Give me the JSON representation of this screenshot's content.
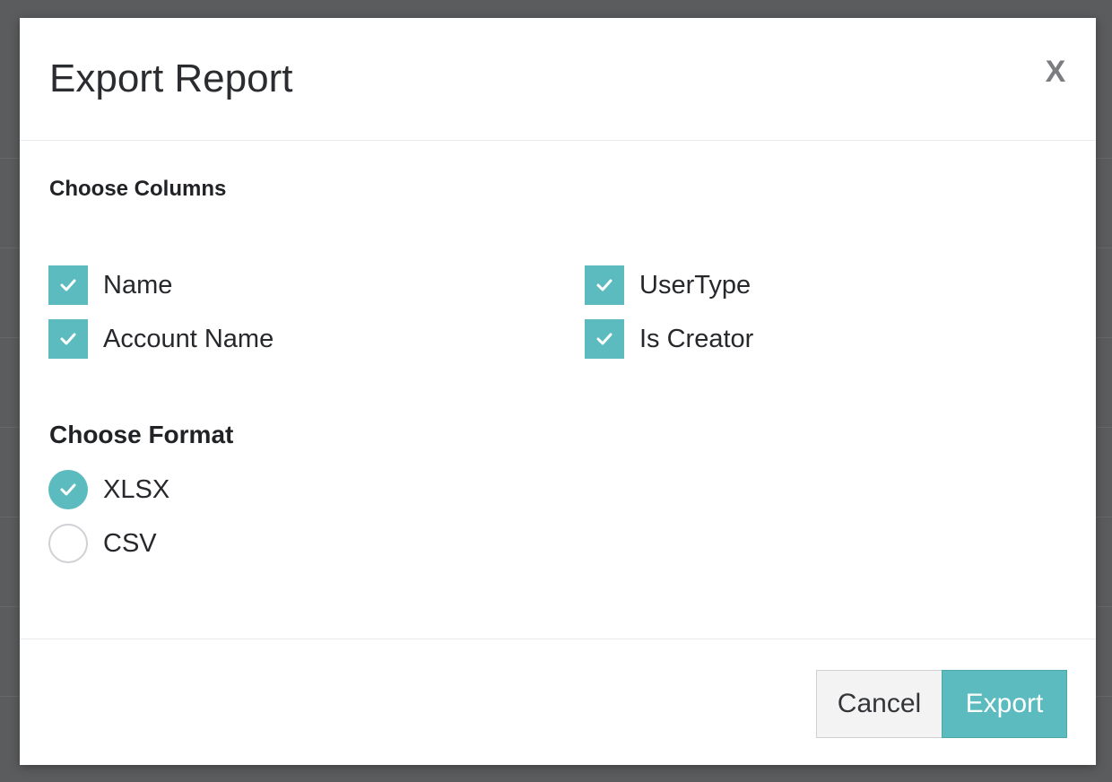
{
  "dialog": {
    "title": "Export Report",
    "close_label": "X"
  },
  "columns": {
    "heading": "Choose Columns",
    "options": [
      {
        "label": "Name",
        "checked": true
      },
      {
        "label": "UserType",
        "checked": true
      },
      {
        "label": "Account Name",
        "checked": true
      },
      {
        "label": "Is Creator",
        "checked": true
      }
    ]
  },
  "format": {
    "heading": "Choose Format",
    "options": [
      {
        "label": "XLSX",
        "selected": true
      },
      {
        "label": "CSV",
        "selected": false
      }
    ]
  },
  "footer": {
    "cancel_label": "Cancel",
    "export_label": "Export"
  },
  "colors": {
    "accent": "#5bbbbf",
    "overlay": "#5b5c5e"
  }
}
